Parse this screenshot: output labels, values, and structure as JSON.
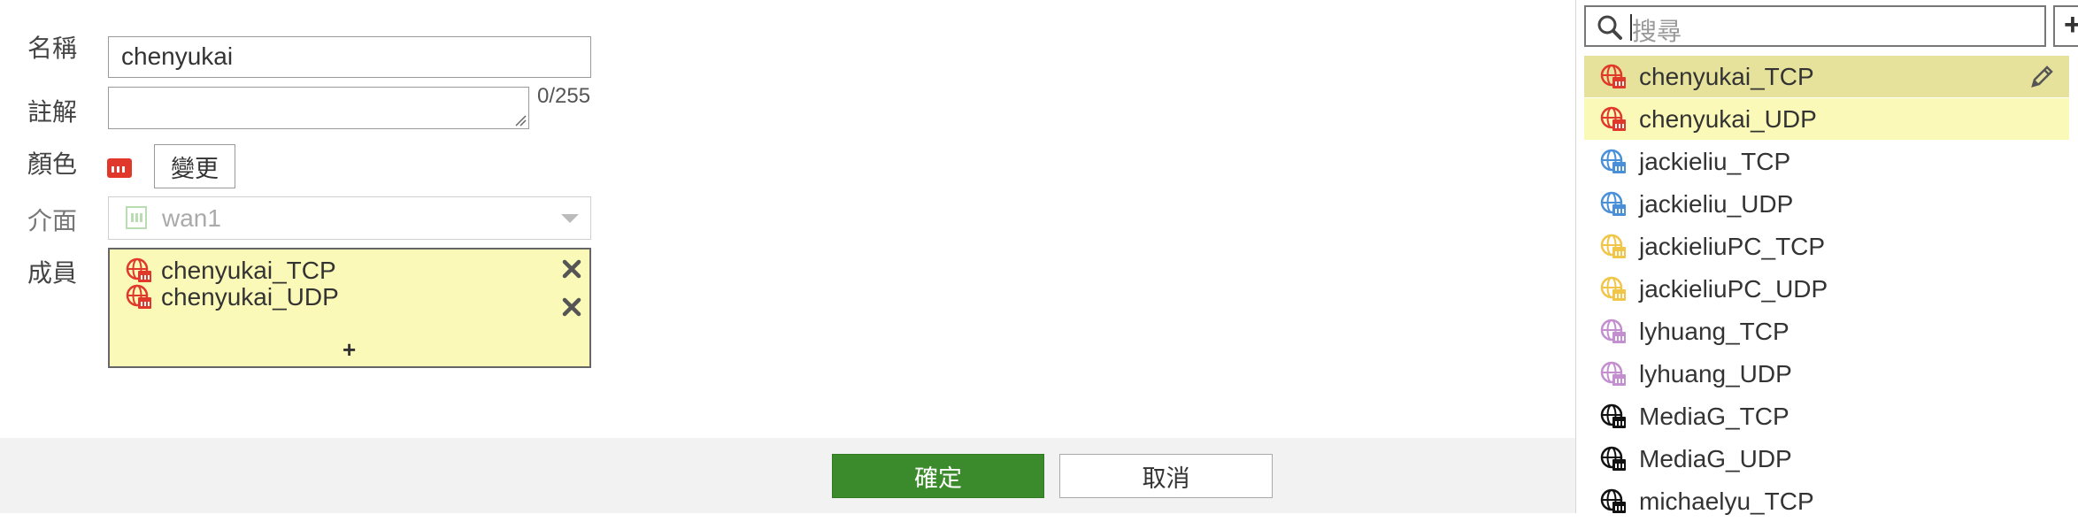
{
  "form": {
    "name_label": "名稱",
    "name_value": "chenyukai",
    "comment_label": "註解",
    "comment_value": "",
    "comment_counter": "0/255",
    "color_label": "顏色",
    "color_change_button": "變更",
    "interface_label": "介面",
    "interface_value": "wan1",
    "members_label": "成員",
    "members": [
      "chenyukai_TCP",
      "chenyukai_UDP"
    ],
    "add_member": "+"
  },
  "footer": {
    "ok_label": "確定",
    "cancel_label": "取消"
  },
  "panel": {
    "search_placeholder": "搜尋",
    "plus_label": "+",
    "items": [
      {
        "label": "chenyukai_TCP",
        "color": "#e0392b"
      },
      {
        "label": "chenyukai_UDP",
        "color": "#e0392b"
      },
      {
        "label": "jackieliu_TCP",
        "color": "#4a90d9"
      },
      {
        "label": "jackieliu_UDP",
        "color": "#4a90d9"
      },
      {
        "label": "jackieliuPC_TCP",
        "color": "#f0c548"
      },
      {
        "label": "jackieliuPC_UDP",
        "color": "#f0c548"
      },
      {
        "label": "lyhuang_TCP",
        "color": "#c48fd0"
      },
      {
        "label": "lyhuang_UDP",
        "color": "#c48fd0"
      },
      {
        "label": "MediaG_TCP",
        "color": "#111111"
      },
      {
        "label": "MediaG_UDP",
        "color": "#111111"
      },
      {
        "label": "michaelyu_TCP",
        "color": "#111111"
      }
    ]
  },
  "colors": {
    "accent_green": "#3b8b2c",
    "selected_bg": "#e6e29c",
    "highlight_bg": "#fbf9b7"
  }
}
